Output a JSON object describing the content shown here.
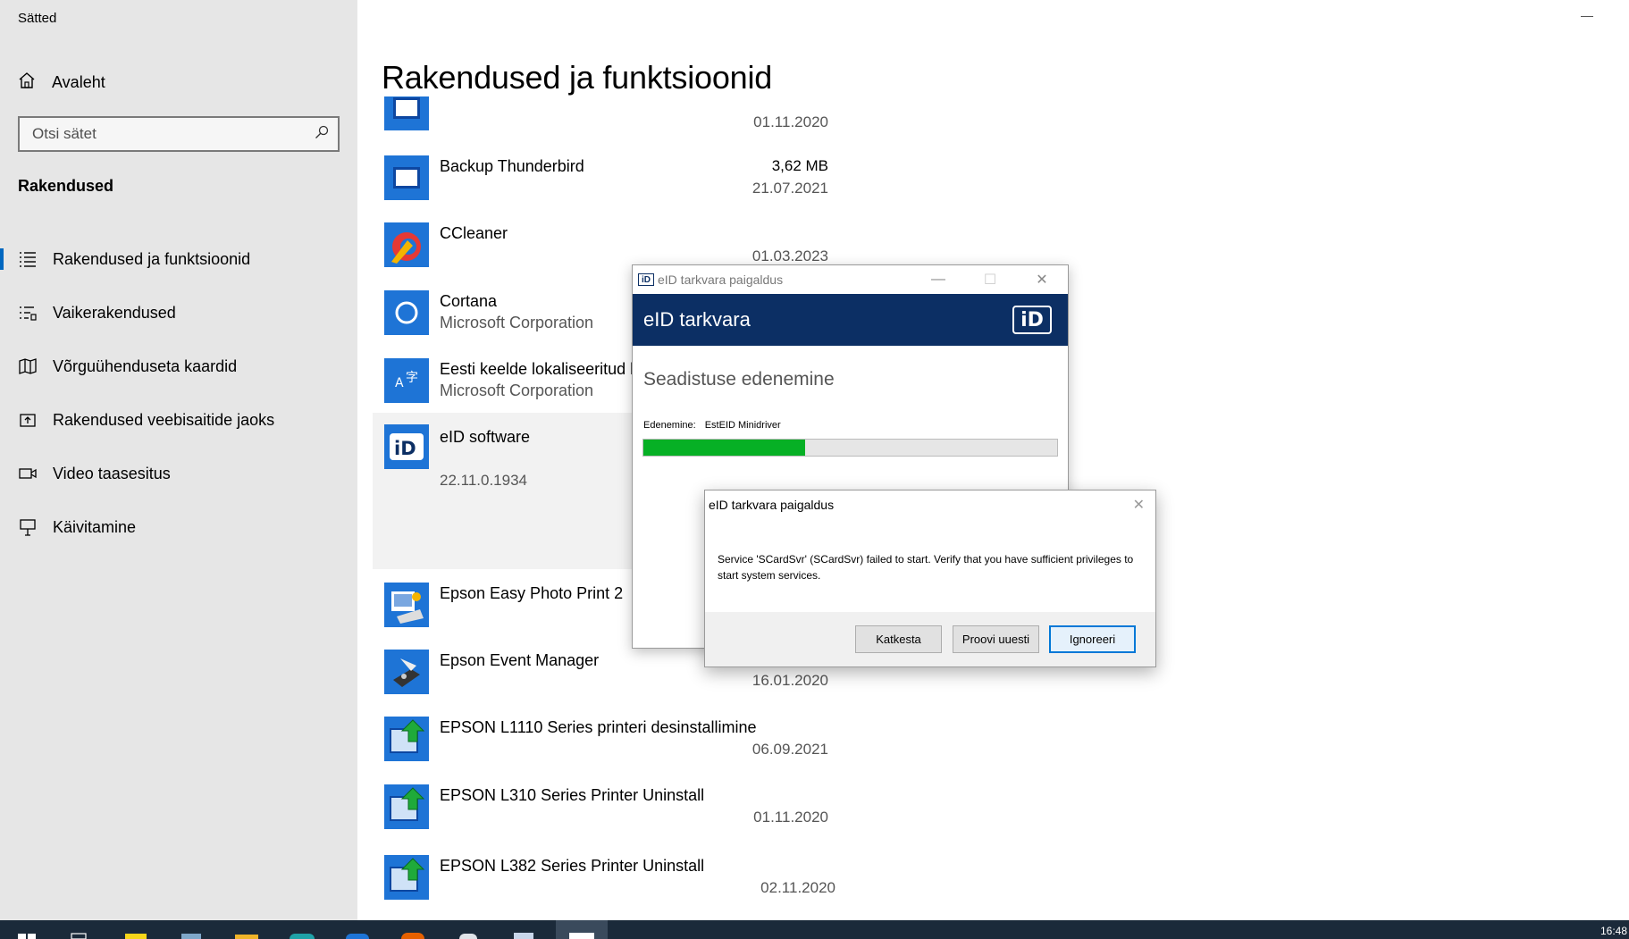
{
  "window": {
    "title": "Sätted"
  },
  "sidebar": {
    "home_label": "Avaleht",
    "search_placeholder": "Otsi sätet",
    "section_title": "Rakendused",
    "items": [
      {
        "label": "Rakendused ja funktsioonid",
        "icon": "list-icon",
        "active": true
      },
      {
        "label": "Vaikerakendused",
        "icon": "default-apps-icon"
      },
      {
        "label": "Võrguühenduseta kaardid",
        "icon": "map-icon"
      },
      {
        "label": "Rakendused veebisaitide jaoks",
        "icon": "web-apps-icon"
      },
      {
        "label": "Video taasesitus",
        "icon": "video-icon"
      },
      {
        "label": "Käivitamine",
        "icon": "startup-icon"
      }
    ]
  },
  "main": {
    "page_title": "Rakendused ja funktsioonid",
    "apps": [
      {
        "name": "",
        "publisher": "",
        "size": "",
        "date": "01.11.2020",
        "icon": "blue-app-icon"
      },
      {
        "name": "Backup Thunderbird",
        "publisher": "",
        "size": "3,62 MB",
        "date": "21.07.2021",
        "icon": "blue-app-icon"
      },
      {
        "name": "CCleaner",
        "publisher": "",
        "size": "",
        "date": "01.03.2023",
        "icon": "ccleaner-icon"
      },
      {
        "name": "Cortana",
        "publisher": "Microsoft Corporation",
        "size": "",
        "date": "",
        "icon": "cortana-icon"
      },
      {
        "name": "Eesti keelde lokaliseeritud ka",
        "publisher": "Microsoft Corporation",
        "size": "",
        "date": "",
        "icon": "language-icon"
      },
      {
        "name": "eID software",
        "publisher": "",
        "version": "22.11.0.1934",
        "size": "",
        "date": "",
        "icon": "eid-icon",
        "selected": true
      },
      {
        "name": "Epson Easy Photo Print 2",
        "publisher": "",
        "size": "",
        "date": "",
        "icon": "epson-photo-icon"
      },
      {
        "name": "Epson Event Manager",
        "publisher": "",
        "size": "",
        "date": "16.01.2020",
        "icon": "epson-event-icon"
      },
      {
        "name": "EPSON L1110 Series printeri desinstallimine",
        "publisher": "",
        "size": "",
        "date": "06.09.2021",
        "icon": "epson-uninstall-icon"
      },
      {
        "name": "EPSON L310 Series Printer Uninstall",
        "publisher": "",
        "size": "",
        "date": "01.11.2020",
        "icon": "epson-uninstall-icon"
      },
      {
        "name": "EPSON L382 Series Printer Uninstall",
        "publisher": "",
        "size": "",
        "date": "02.11.2020",
        "icon": "epson-uninstall-icon"
      }
    ]
  },
  "installer": {
    "title": "eID tarkvara paigaldus",
    "banner_title": "eID tarkvara",
    "logo_text": "iD",
    "subtitle": "Seadistuse edenemine",
    "progress_label": "Edenemine:",
    "progress_value": "EstEID Minidriver",
    "progress_fraction": 0.39
  },
  "error_dialog": {
    "title": "eID tarkvara paigaldus",
    "message": "Service 'SCardSvr' (SCardSvr) failed to start.  Verify that you have sufficient privileges to start system services.",
    "buttons": {
      "cancel": "Katkesta",
      "retry": "Proovi uuesti",
      "ignore": "Ignoreeri"
    }
  },
  "taskbar": {
    "time": "16:48"
  },
  "colors": {
    "accent": "#0067c0",
    "eid_navy": "#0c2f64",
    "progress_green": "#06b025"
  }
}
